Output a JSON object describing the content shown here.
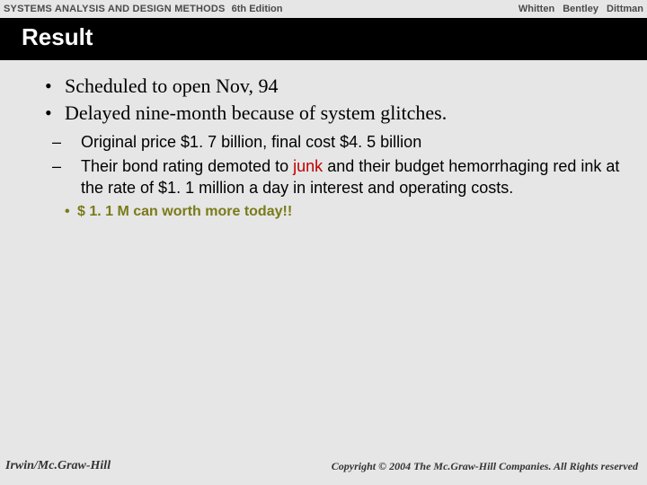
{
  "topbar": {
    "book": "SYSTEMS ANALYSIS AND DESIGN METHODS",
    "edition": "6th Edition",
    "authors": [
      "Whitten",
      "Bentley",
      "Dittman"
    ]
  },
  "title": "Result",
  "bullets": {
    "b1": "Scheduled to open Nov, 94",
    "b2": "Delayed nine-month because of system glitches.",
    "sub1": "Original price $1. 7 billion, final cost $4. 5 billion",
    "sub2_a": "Their bond rating demoted to ",
    "sub2_junk": "junk",
    "sub2_b": " and their budget hemorrhaging red ink at the rate of $1. 1 million a day in interest and operating costs.",
    "sub3": "$ 1. 1 M can worth more today!!"
  },
  "footer": {
    "publisher": "Irwin/Mc.Graw-Hill",
    "copyright": "Copyright © 2004 The Mc.Graw-Hill Companies. All Rights reserved"
  }
}
